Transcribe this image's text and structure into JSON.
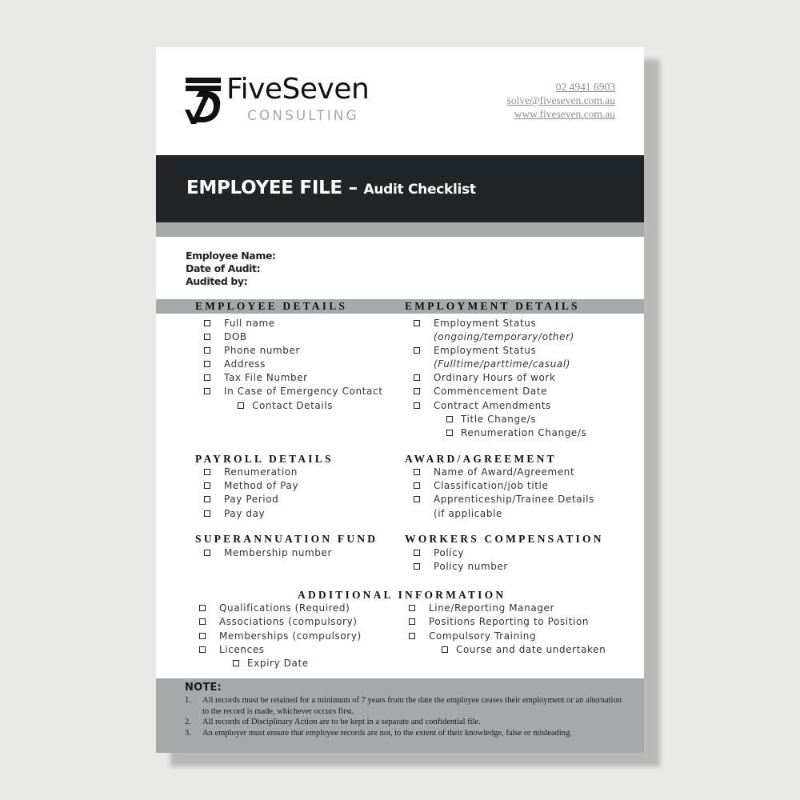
{
  "brand": {
    "name": "FiveSeven",
    "tagline": "CONSULTING",
    "logo_icon": "57-monogram-logo"
  },
  "contact": {
    "phone": "02 4941 6903",
    "email": "solve@fiveseven.com.au",
    "website": "www.fiveseven.com.au"
  },
  "banner": {
    "title": "EMPLOYEE FILE",
    "dash": " – ",
    "subtitle": "Audit Checklist"
  },
  "fields": {
    "employee_name": "Employee Name:",
    "date_of_audit": "Date of Audit:",
    "audited_by": "Audited by:"
  },
  "sections": {
    "employee_details": {
      "heading": "EMPLOYEE DETAILS",
      "items": [
        "Full name",
        "DOB",
        "Phone number",
        "Address",
        "Tax File Number",
        "In Case of Emergency Contact"
      ],
      "subitems": [
        "Contact Details"
      ]
    },
    "employment_details": {
      "heading": "EMPLOYMENT DETAILS",
      "items": [
        {
          "label": "Employment Status",
          "note": "(ongoing/temporary/other)"
        },
        {
          "label": "Employment Status",
          "note": "(Fulltime/parttime/casual)"
        },
        {
          "label": "Ordinary Hours of work"
        },
        {
          "label": "Commencement Date"
        },
        {
          "label": "Contract Amendments"
        }
      ],
      "subitems": [
        "Title Change/s",
        "Renumeration Change/s"
      ]
    },
    "payroll_details": {
      "heading": "PAYROLL DETAILS",
      "items": [
        "Renumeration",
        "Method of Pay",
        "Pay Period",
        "Pay day"
      ]
    },
    "award_agreement": {
      "heading": "AWARD/AGREEMENT",
      "items": [
        "Name of Award/Agreement",
        "Classification/job title",
        "Apprenticeship/Trainee Details"
      ],
      "continuation": "(if applicable"
    },
    "superannuation_fund": {
      "heading": "SUPERANNUATION FUND",
      "items": [
        "Membership number"
      ]
    },
    "workers_compensation": {
      "heading": "WORKERS COMPENSATION",
      "items": [
        "Policy",
        "Policy number"
      ]
    },
    "additional_information": {
      "heading": "ADDITIONAL INFORMATION",
      "left_items": [
        "Qualifications (Required)",
        "Associations (compulsory)",
        "Memberships (compulsory)",
        "Licences"
      ],
      "left_subitems": [
        "Expiry Date"
      ],
      "right_items": [
        "Line/Reporting Manager",
        "Positions Reporting to Position",
        "Compulsory Training"
      ],
      "right_subitems": [
        "Course and date undertaken"
      ]
    }
  },
  "note": {
    "heading": "NOTE:",
    "items": [
      {
        "num": "1.",
        "text": "All records must be retained for a minimum of 7 years from the date the employee ceases their employment or an alternation to the record is made, whichever occurs first."
      },
      {
        "num": "2.",
        "text": "All records of Disciplinary Action are to be kept in a separate and confidential file."
      },
      {
        "num": "3.",
        "text": "An employer must ensure that employee records are not, to the extent of their knowledge, false or misleading."
      }
    ]
  }
}
